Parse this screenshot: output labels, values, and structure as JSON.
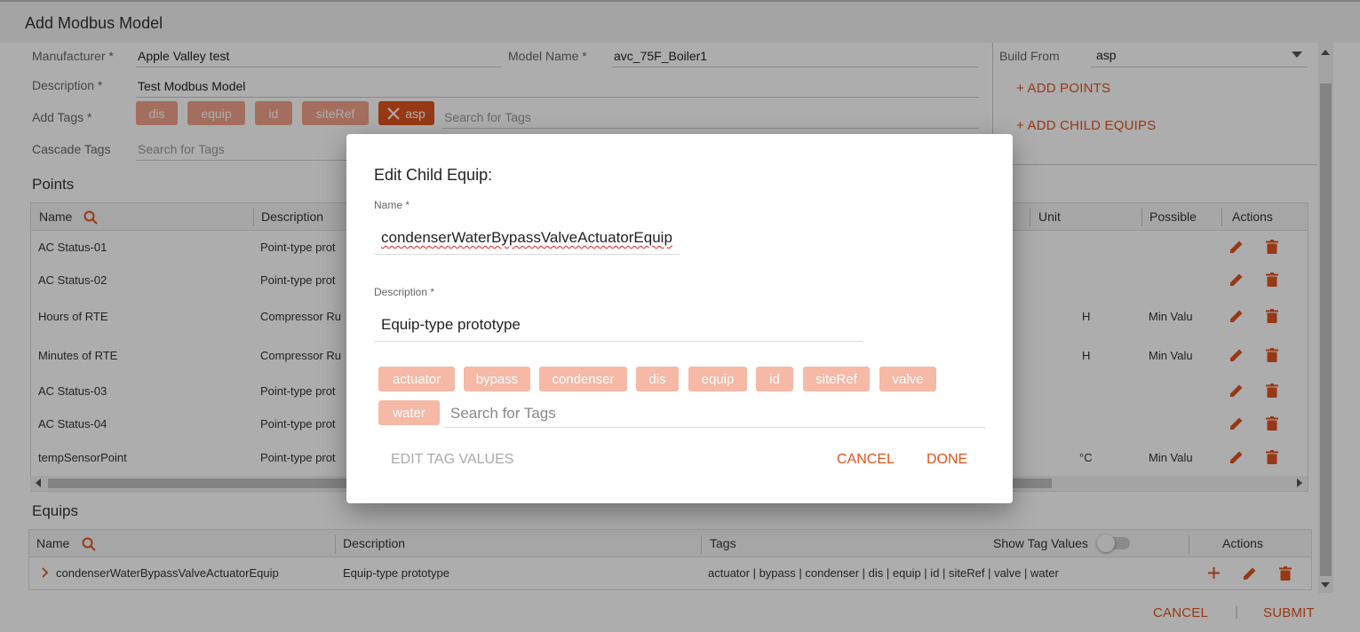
{
  "window": {
    "title": "Add Modbus Model"
  },
  "form": {
    "manufacturer_label": "Manufacturer *",
    "manufacturer_value": "Apple Valley test",
    "model_name_label": "Model Name *",
    "model_name_value": "avc_75F_Boiler1",
    "description_label": "Description *",
    "description_value": "Test Modbus Model",
    "add_tags_label": "Add Tags *",
    "tags": [
      "dis",
      "equip",
      "id",
      "siteRef",
      "asp"
    ],
    "tags_search_placeholder": "Search for Tags",
    "cascade_tags_label": "Cascade Tags",
    "cascade_search_placeholder": "Search for Tags"
  },
  "build": {
    "label": "Build From",
    "value": "asp",
    "add_points": "+ ADD POINTS",
    "add_child_equips": "+ ADD CHILD EQUIPS"
  },
  "points": {
    "title": "Points",
    "headers": {
      "name": "Name",
      "description": "Description",
      "unit": "Unit",
      "possible": "Possible",
      "actions": "Actions"
    },
    "rows": [
      {
        "name": "AC Status-01",
        "description": "Point-type prot",
        "unit": "",
        "possible": ""
      },
      {
        "name": "AC Status-02",
        "description": "Point-type prot",
        "unit": "",
        "possible": ""
      },
      {
        "name": "Hours of RTE",
        "description": "Compressor Ru",
        "unit": "H",
        "possible": "Min Valu"
      },
      {
        "name": "Minutes of RTE",
        "description": "Compressor Ru",
        "unit": "H",
        "possible": "Min Valu"
      },
      {
        "name": "AC Status-03",
        "description": "Point-type prot",
        "unit": "",
        "possible": ""
      },
      {
        "name": "AC Status-04",
        "description": "Point-type prot",
        "unit": "",
        "possible": ""
      },
      {
        "name": "tempSensorPoint",
        "description": "Point-type prot",
        "unit": "°C",
        "possible": "Min Valu"
      }
    ]
  },
  "equips": {
    "title": "Equips",
    "headers": {
      "name": "Name",
      "description": "Description",
      "tags": "Tags",
      "show_tag_values": "Show Tag Values",
      "actions": "Actions"
    },
    "rows": [
      {
        "name": "condenserWaterBypassValveActuatorEquip",
        "description": "Equip-type prototype",
        "tags": "actuator | bypass | condenser | dis | equip | id | siteRef | valve | water"
      }
    ]
  },
  "footer": {
    "cancel": "CANCEL",
    "separator": "|",
    "submit": "SUBMIT"
  },
  "modal": {
    "title": "Edit Child Equip:",
    "name_label": "Name *",
    "name_value": "condenserWaterBypassValveActuatorEquip",
    "description_label": "Description *",
    "description_value": "Equip-type prototype",
    "tags": [
      "actuator",
      "bypass",
      "condenser",
      "dis",
      "equip",
      "id",
      "siteRef",
      "valve",
      "water"
    ],
    "search_placeholder": "Search for Tags",
    "edit_tag_values": "EDIT TAG VALUES",
    "cancel": "CANCEL",
    "done": "DONE"
  },
  "colors": {
    "accent": "#e0531f",
    "chip": "#f2a28b",
    "chip_light": "#f5b9a6",
    "selected_chip": "#e0531f"
  },
  "icons": [
    "search-icon",
    "pencil-icon",
    "trash-icon",
    "close-icon",
    "chevron-right-icon",
    "plus-icon",
    "chevron-down-icon"
  ]
}
